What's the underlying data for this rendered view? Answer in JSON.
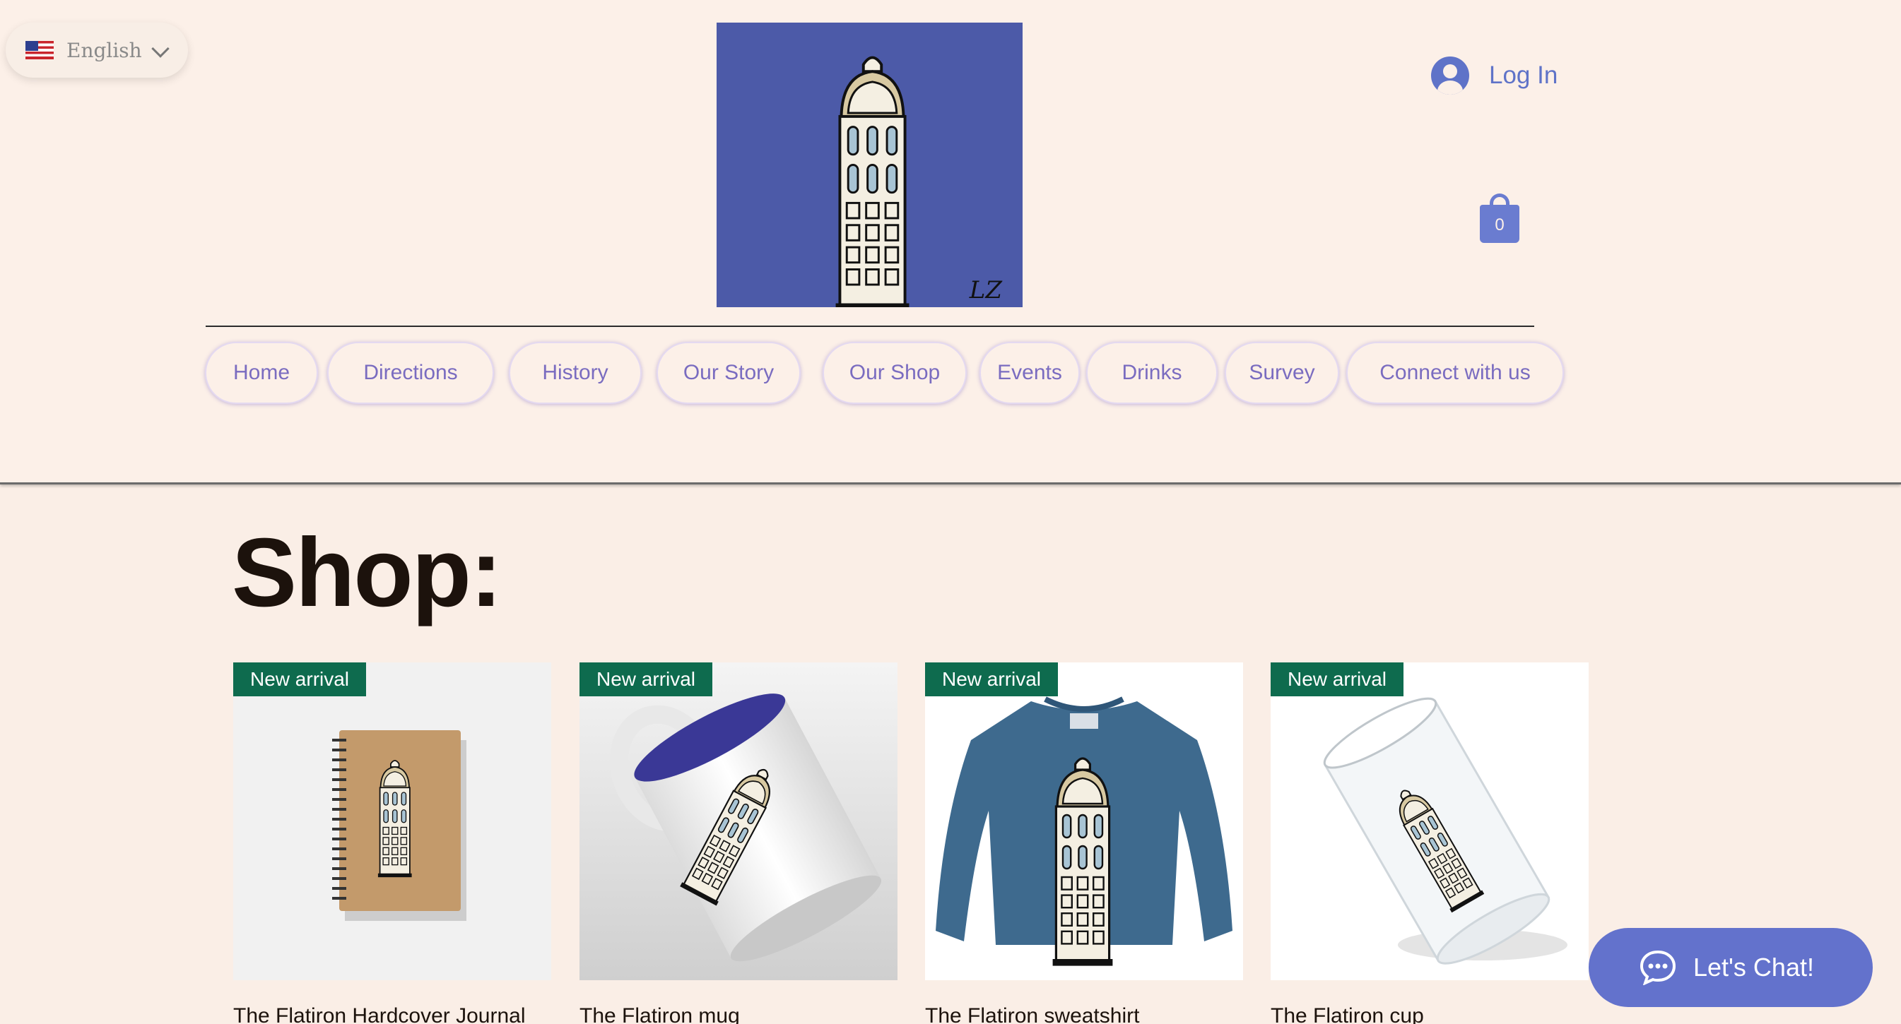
{
  "language": {
    "label": "English",
    "flag_icon": "us-flag-icon"
  },
  "logo": {
    "signature": "LZ",
    "bg_color": "#4c5aa8"
  },
  "account": {
    "login_label": "Log In",
    "cart_count": "0"
  },
  "nav": {
    "items": [
      {
        "label": "Home"
      },
      {
        "label": "Directions"
      },
      {
        "label": "History"
      },
      {
        "label": "Our Story"
      },
      {
        "label": "Our Shop"
      },
      {
        "label": "Events"
      },
      {
        "label": "Drinks"
      },
      {
        "label": "Survey"
      },
      {
        "label": "Connect with us"
      }
    ]
  },
  "shop": {
    "title": "Shop:",
    "products": [
      {
        "badge": "New arrival",
        "name": "The Flatiron Hardcover Journal"
      },
      {
        "badge": "New arrival",
        "name": "The Flatiron mug"
      },
      {
        "badge": "New arrival",
        "name": "The Flatiron sweatshirt"
      },
      {
        "badge": "New arrival",
        "name": "The Flatiron cup"
      }
    ]
  },
  "chat": {
    "label": "Let's Chat!"
  },
  "colors": {
    "accent": "#6372cc",
    "badge": "#0e6b4e",
    "background": "#faeee6"
  }
}
